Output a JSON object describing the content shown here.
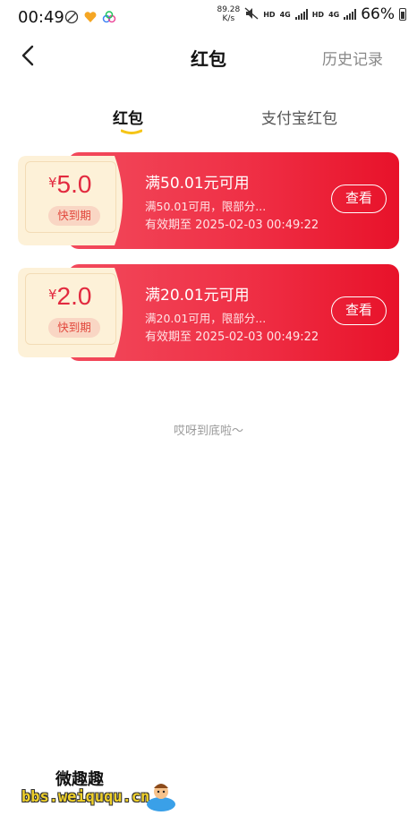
{
  "status_bar": {
    "time": "00:49",
    "net_speed_value": "89.28",
    "net_speed_unit": "K/s",
    "hd_1": "HD",
    "net_type_1": "4G",
    "hd_2": "HD",
    "net_type_2": "4G",
    "battery": "66%",
    "icons": [
      "notification-no-icon",
      "heart-app-icon",
      "cloud-app-icon",
      "mute-icon",
      "signal-icon",
      "signal-icon",
      "battery-icon"
    ]
  },
  "nav": {
    "title": "红包",
    "history": "历史记录"
  },
  "tabs": [
    {
      "label": "红包",
      "active": true
    },
    {
      "label": "支付宝红包",
      "active": false
    }
  ],
  "coupons": [
    {
      "currency": "¥",
      "amount": "5.0",
      "badge": "快到期",
      "title": "满50.01元可用",
      "desc": "满50.01可用，限部分...",
      "valid": "有效期至 2025-02-03 00:49:22",
      "button": "查看"
    },
    {
      "currency": "¥",
      "amount": "2.0",
      "badge": "快到期",
      "title": "满20.01元可用",
      "desc": "满20.01可用，限部分...",
      "valid": "有效期至 2025-02-03 00:49:22",
      "button": "查看"
    }
  ],
  "end_text": "哎呀到底啦～",
  "watermark": {
    "top": "微趣趣",
    "bottom": "bbs.weiququ.cn"
  },
  "colors": {
    "accent_red": "#e8122a",
    "stub_bg": "#fdf1d8",
    "tab_underline": "#f5c518"
  }
}
